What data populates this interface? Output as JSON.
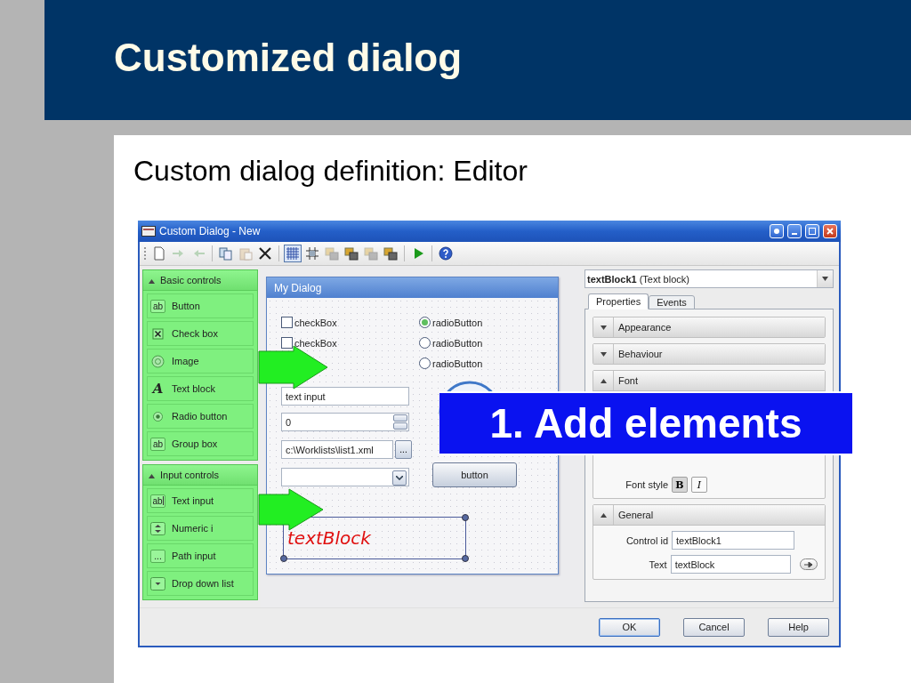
{
  "slide": {
    "title": "Customized dialog",
    "subtitle": "Custom dialog definition: Editor"
  },
  "window": {
    "title": "Custom Dialog - New"
  },
  "toolbar_groups": [
    [
      {
        "kind": "new",
        "disabled": false,
        "pressed": false
      },
      {
        "kind": "import",
        "disabled": true,
        "pressed": false
      },
      {
        "kind": "export",
        "disabled": true,
        "pressed": false
      }
    ],
    [
      {
        "kind": "copy",
        "disabled": false,
        "pressed": false
      },
      {
        "kind": "paste",
        "disabled": true,
        "pressed": false
      },
      {
        "kind": "delete",
        "disabled": false,
        "pressed": false
      }
    ],
    [
      {
        "kind": "grid",
        "disabled": false,
        "pressed": true
      },
      {
        "kind": "snap",
        "disabled": false,
        "pressed": false
      },
      {
        "kind": "layer",
        "disabled": true,
        "pressed": false
      },
      {
        "kind": "layer",
        "disabled": false,
        "pressed": false
      },
      {
        "kind": "layer",
        "disabled": true,
        "pressed": false
      },
      {
        "kind": "layer",
        "disabled": false,
        "pressed": false
      }
    ],
    [
      {
        "kind": "run",
        "disabled": false,
        "pressed": false
      }
    ],
    [
      {
        "kind": "help",
        "disabled": false,
        "pressed": false
      }
    ]
  ],
  "palette": [
    {
      "title": "Basic controls",
      "expanded": true,
      "items": [
        {
          "kind": "button",
          "icon_text": "ab",
          "label": "Button"
        },
        {
          "kind": "checkbox",
          "label": "Check box"
        },
        {
          "kind": "image",
          "label": "Image"
        },
        {
          "kind": "text_block",
          "icon_text": "A",
          "label": "Text block"
        },
        {
          "kind": "radio",
          "label": "Radio button"
        },
        {
          "kind": "group_box",
          "icon_text": "ab",
          "label": "Group box"
        }
      ]
    },
    {
      "title": "Input controls",
      "expanded": true,
      "items": [
        {
          "kind": "text_input",
          "icon_text": "ab",
          "label": "Text input"
        },
        {
          "kind": "numeric",
          "label": "Numeric i"
        },
        {
          "kind": "path",
          "icon_text": "...",
          "label": "Path input"
        },
        {
          "kind": "dropdown",
          "label": "Drop down list"
        }
      ]
    }
  ],
  "designer": {
    "title": "My Dialog",
    "controls": [
      {
        "kind": "checkbox",
        "label": "checkBox",
        "checked": false
      },
      {
        "kind": "checkbox",
        "label": "checkBox",
        "checked": false
      },
      {
        "kind": "radio",
        "label": "radioButton",
        "selected": true
      },
      {
        "kind": "radio",
        "label": "radioButton",
        "selected": false
      },
      {
        "kind": "radio",
        "label": "radioButton",
        "selected": false
      },
      {
        "kind": "image"
      },
      {
        "kind": "text_input",
        "value": "text input"
      },
      {
        "kind": "numeric",
        "value": "0"
      },
      {
        "kind": "path",
        "value": "c:\\Worklists\\list1.xml",
        "button_label": "..."
      },
      {
        "kind": "dropdown"
      },
      {
        "kind": "button",
        "label": "button"
      },
      {
        "kind": "text_block",
        "text": "textBlock",
        "selected": true
      }
    ]
  },
  "properties": {
    "object": "**textBlock1** (Text block)",
    "tabs": [
      {
        "label": "Properties",
        "selected": true
      },
      {
        "label": "Events",
        "selected": false
      }
    ],
    "sections": [
      {
        "kind": "plain",
        "title": "Appearance",
        "expanded": false
      },
      {
        "kind": "plain",
        "title": "Behaviour",
        "expanded": false
      },
      {
        "kind": "font",
        "title": "Font",
        "expanded": true,
        "font_style_label": "Font style",
        "font_styles": [
          {
            "label": "B",
            "selected": true
          },
          {
            "label": "I",
            "selected": false
          }
        ]
      },
      {
        "kind": "fields",
        "title": "General",
        "expanded": true,
        "fields": [
          {
            "label": "Control id",
            "value": "textBlock1",
            "has_button": false
          },
          {
            "label": "Text",
            "value": "textBlock",
            "has_button": true
          }
        ]
      }
    ]
  },
  "buttons": [
    {
      "label": "OK",
      "default": true
    },
    {
      "label": "Cancel",
      "default": false
    },
    {
      "label": "Help",
      "default": false
    }
  ],
  "callout": {
    "text": "1. Add elements"
  }
}
